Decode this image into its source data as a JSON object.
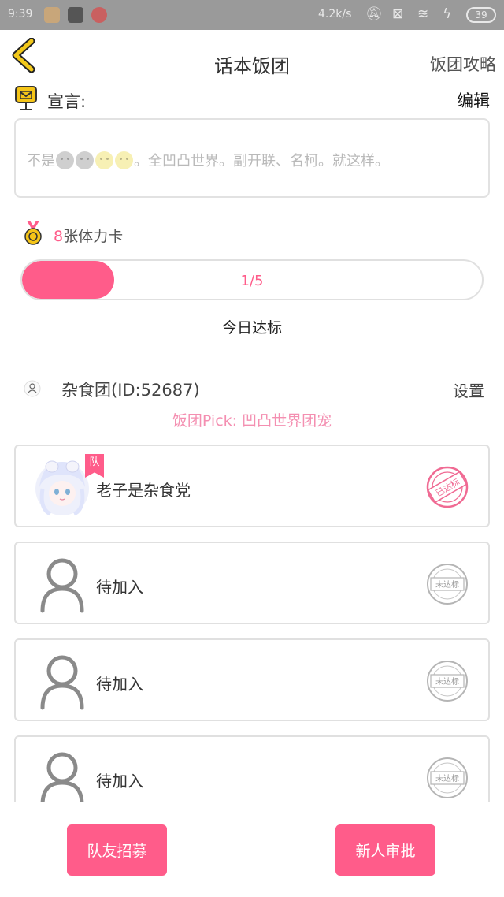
{
  "status_bar": {
    "time": "9:39",
    "net_speed": "4.2k/s",
    "battery": "39"
  },
  "header": {
    "title": "话本饭团",
    "strategy_link": "饭团攻略"
  },
  "announcement": {
    "label": "宣言:",
    "edit": "编辑",
    "text_before": "不是",
    "text_after": "。全凹凸世界。副开联、名柯。就这样。"
  },
  "stamina": {
    "count": "8",
    "suffix": "张体力卡"
  },
  "progress": {
    "text": "1/5",
    "current": 1,
    "total": 5,
    "caption": "今日达标"
  },
  "team": {
    "name": "杂食团(ID:52687)",
    "settings": "设置",
    "pick": "饭团Pick: 凹凸世界团宠"
  },
  "members": [
    {
      "name": "老子是杂食党",
      "leader_badge": "队",
      "status": "已达标",
      "achieved": true
    },
    {
      "name": "待加入",
      "status": "未达标",
      "achieved": false
    },
    {
      "name": "待加入",
      "status": "未达标",
      "achieved": false
    },
    {
      "name": "待加入",
      "status": "未达标",
      "achieved": false
    }
  ],
  "bottom": {
    "recruit": "队友招募",
    "approve": "新人审批"
  },
  "colors": {
    "accent": "#ff5c8a",
    "back_arrow": "#f2c81a",
    "status_bar": "#9a9a9a"
  }
}
